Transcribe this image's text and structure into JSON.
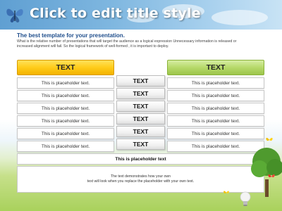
{
  "header": {
    "title": "Click to edit title style",
    "icon": "butterfly-icon"
  },
  "intro": {
    "subtitle": "The best template for your presentation.",
    "description_line1": "What is the relative number of presentations that will target the audience as a logical expression Unnecessary information is released or",
    "description_line2": "increased alignment will fail. So the logical framework of well-formed , it is important to deploy."
  },
  "table": {
    "left_header": "TEXT",
    "right_header": "TEXT",
    "rows": [
      {
        "left": "This is placeholder text.",
        "middle": "TEXT",
        "right": "This is placeholder text."
      },
      {
        "left": "This is placeholder text.",
        "middle": "TEXT",
        "right": "This is placeholder text."
      },
      {
        "left": "This is placeholder text.",
        "middle": "TEXT",
        "right": "This is placeholder text."
      },
      {
        "left": "This is placeholder text.",
        "middle": "TEXT",
        "right": "This is placeholder text."
      },
      {
        "left": "This is placeholder text.",
        "middle": "TEXT",
        "right": "This is placeholder text."
      },
      {
        "left": "This is placeholder text.",
        "middle": "TEXT",
        "right": "This is placeholder text."
      }
    ]
  },
  "note": {
    "title": "This is placeholder text",
    "body_line1": "The text demonstrates how your own",
    "body_line2": "text will look when you replace the placeholder with your own text."
  },
  "colors": {
    "header_sky": "#6fa9d8",
    "left_header": "#ffcc1a",
    "right_header": "#b6d96a",
    "grass": "#a9d15c"
  }
}
